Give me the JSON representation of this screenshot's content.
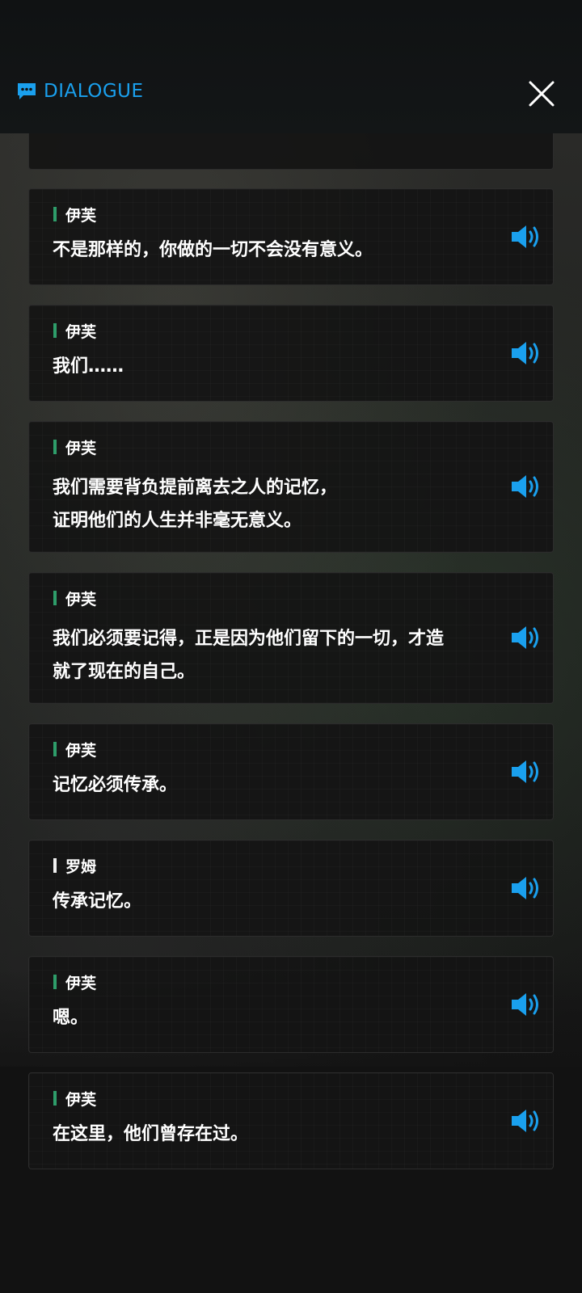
{
  "header": {
    "title": "DIALOGUE"
  },
  "entries": [
    {
      "speaker": "伊芙",
      "speaker_color": "#2e9d6a",
      "text": "不是那样的，你做的一切不会没有意义。"
    },
    {
      "speaker": "伊芙",
      "speaker_color": "#2e9d6a",
      "text": "我们……"
    },
    {
      "speaker": "伊芙",
      "speaker_color": "#2e9d6a",
      "text_lines": [
        "我们需要背负提前离去之人的记忆，",
        "证明他们的人生并非毫无意义。"
      ]
    },
    {
      "speaker": "伊芙",
      "speaker_color": "#2e9d6a",
      "text_lines": [
        "我们必须要记得，正是因为他们留下的一切，才造",
        "就了现在的自己。"
      ]
    },
    {
      "speaker": "伊芙",
      "speaker_color": "#2e9d6a",
      "text": "记忆必须传承。"
    },
    {
      "speaker": "罗姆",
      "speaker_color": "#f0f0f0",
      "text": "传承记忆。"
    },
    {
      "speaker": "伊芙",
      "speaker_color": "#2e9d6a",
      "text": "嗯。"
    },
    {
      "speaker": "伊芙",
      "speaker_color": "#2e9d6a",
      "text": "在这里，他们曾存在过。"
    }
  ],
  "colors": {
    "accent": "#1aa0ee",
    "card_bg": "#141414"
  },
  "icons": {
    "title": "chat-bubble-icon",
    "close": "close-icon",
    "voice": "speaker-volume-icon"
  }
}
